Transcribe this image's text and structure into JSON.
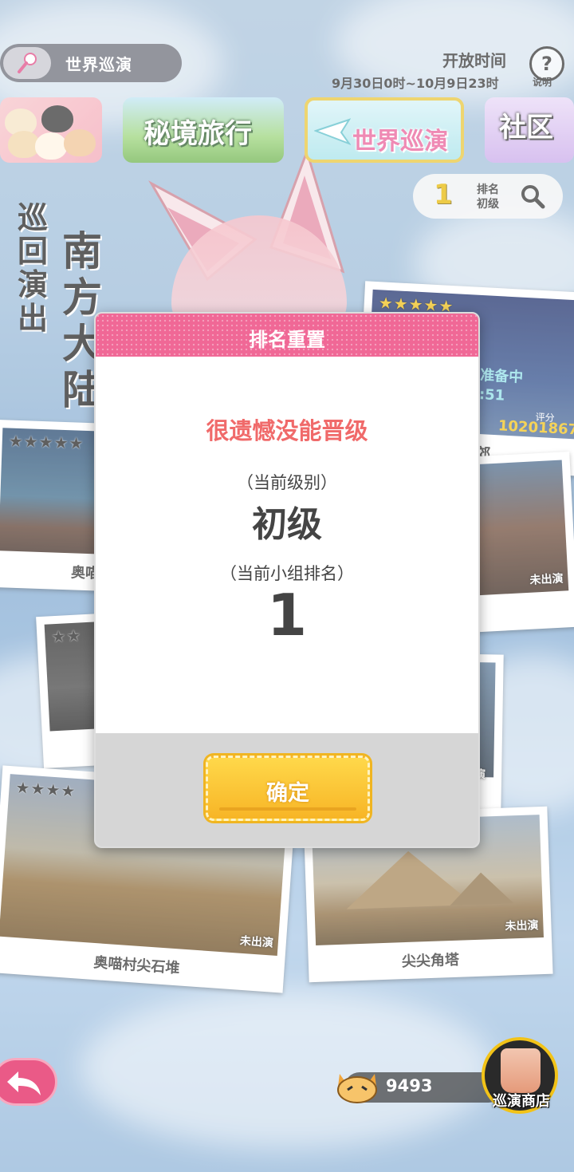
{
  "header": {
    "mode_label": "世界巡演",
    "open_time_title": "开放时间",
    "open_time_range": "9月30日0时~10月9日23时",
    "help_icon_text": "?",
    "help_label": "说明"
  },
  "tabs": [
    {
      "label": ""
    },
    {
      "label": "秘境旅行"
    },
    {
      "label": "世界巡演"
    },
    {
      "label": "社区"
    }
  ],
  "rank": {
    "number": "1",
    "label_line1": "排名",
    "label_line2": "初级"
  },
  "title": {
    "tour_chars": [
      "巡",
      "回",
      "演",
      "出"
    ],
    "continent_chars": [
      "南",
      "方",
      "大",
      "陆"
    ]
  },
  "cards": {
    "top_right": {
      "status": "准备中",
      "time": ":51",
      "score_label": "评分",
      "score": "10201867",
      "name": "城郊"
    },
    "left_1": {
      "stars": "★★★★★",
      "name": "奥喵"
    },
    "right_2": {
      "unplayed": "未出演"
    },
    "left_2": {
      "stars": "★★"
    },
    "right_3": {
      "unplayed": "演"
    },
    "left_3": {
      "stars": "★★★★",
      "name": "奥喵村尖石堆",
      "unplayed": "未出演"
    },
    "right_4": {
      "name": "尖尖角塔",
      "unplayed": "未出演"
    },
    "top_right_stars": "★★★★★"
  },
  "dialog": {
    "title": "排名重置",
    "message": "很遗憾没能晋级",
    "level_label": "（当前级别）",
    "level": "初级",
    "rank_label": "（当前小组排名）",
    "rank": "1",
    "confirm_label": "确定"
  },
  "bottom": {
    "coins": "9493",
    "shop_label": "巡演商店"
  },
  "colors": {
    "dialog_header": "#f06896",
    "message": "#f06a6a",
    "confirm_button": "#f7b526",
    "back_button": "#ea5a87"
  }
}
